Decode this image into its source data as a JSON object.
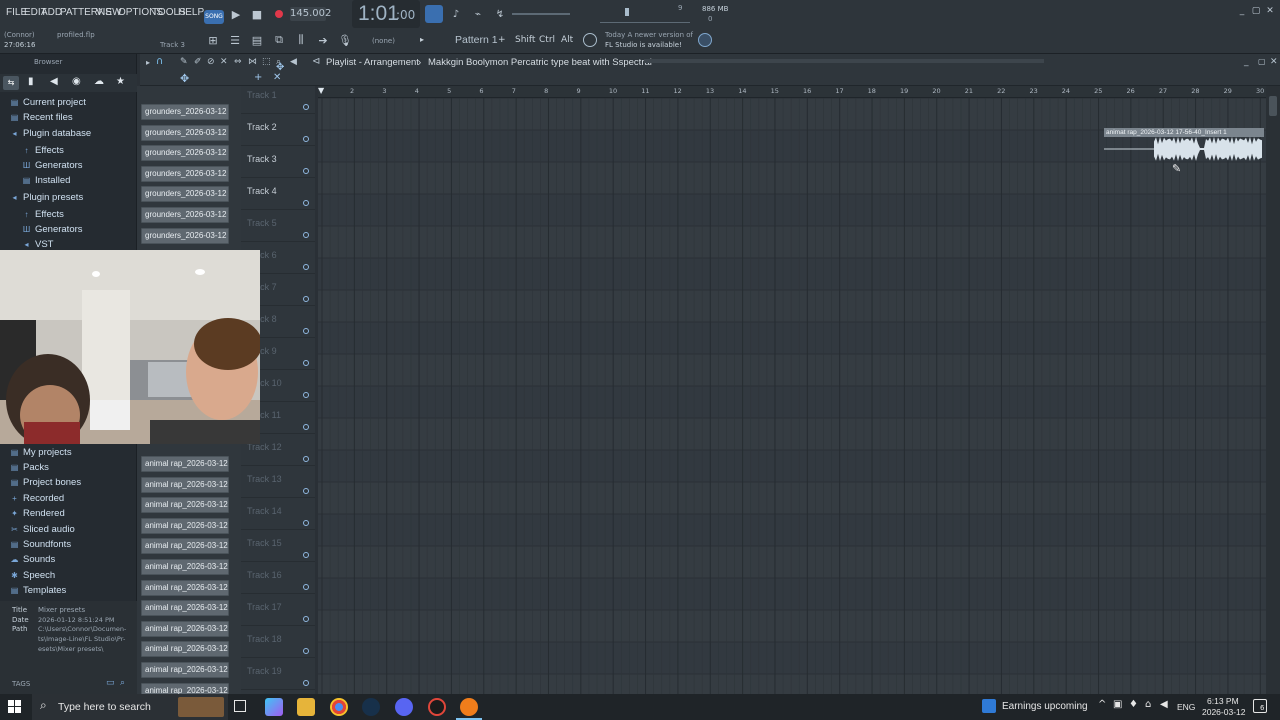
{
  "menu": {
    "items": [
      "FILE",
      "EDIT",
      "ADD",
      "PATTERNS",
      "VIEW",
      "OPTIONS",
      "TOOLS",
      "HELP"
    ]
  },
  "transport": {
    "mode_label": "SONG",
    "tempo": "145.002",
    "time": "1:01",
    "time_sub": ":00",
    "pattern": "Pattern 1",
    "pattern_none": "(none)",
    "memory": "886 MB",
    "cpu_top": "9",
    "cpu_bottom": "0"
  },
  "hint": {
    "line1": "(Connor)",
    "line2": "profiled.flp",
    "line3": "27:06:16",
    "track_label": "Track 3"
  },
  "modifiers": {
    "shift": "Shift",
    "ctrl": "Ctrl",
    "alt": "Alt"
  },
  "news": {
    "line1": "Today  A newer version of",
    "line2": "FL Studio is available!"
  },
  "playlist": {
    "breadcrumb": "Playlist - Arrangement",
    "project": "Makkgin Boolymon Percatric type beat with Sspectral",
    "clip_label": "animat rap_2026-03-12 17-56-40_Insert 1"
  },
  "browser": {
    "title": "Browser",
    "items": [
      {
        "label": "Current project",
        "icon": "folder-icon"
      },
      {
        "label": "Recent files",
        "icon": "folder-icon"
      },
      {
        "label": "Plugin database",
        "icon": "plug-icon"
      },
      {
        "label": "Effects",
        "icon": "effects-icon"
      },
      {
        "label": "Generators",
        "icon": "generators-icon"
      },
      {
        "label": "Installed",
        "icon": "installed-icon"
      },
      {
        "label": "Plugin presets",
        "icon": "plug-icon"
      },
      {
        "label": "Effects",
        "icon": "effects-icon"
      },
      {
        "label": "Generators",
        "icon": "generators-icon"
      },
      {
        "label": "VST",
        "icon": "vst-icon"
      }
    ],
    "items2": [
      {
        "label": "My projects",
        "icon": "folder-icon"
      },
      {
        "label": "Packs",
        "icon": "folder-icon"
      },
      {
        "label": "Project bones",
        "icon": "folder-icon"
      },
      {
        "label": "Recorded",
        "icon": "recorded-icon"
      },
      {
        "label": "Rendered",
        "icon": "rendered-icon"
      },
      {
        "label": "Sliced audio",
        "icon": "sliced-icon"
      },
      {
        "label": "Soundfonts",
        "icon": "soundfonts-icon"
      },
      {
        "label": "Sounds",
        "icon": "sounds-icon"
      },
      {
        "label": "Speech",
        "icon": "speech-icon"
      },
      {
        "label": "Templates",
        "icon": "folder-icon"
      }
    ],
    "info": {
      "title_k": "Title",
      "title_v": "Mixer presets",
      "date_k": "Date",
      "date_v": "2026-01-12 8:51:24 PM",
      "path_k": "Path",
      "path_v1": "C:\\Users\\Connor\\Documen-",
      "path_v2": "ts\\Image-Line\\FL Studio\\Pr-",
      "path_v3": "esets\\Mixer presets\\"
    },
    "tags": "TAGS"
  },
  "clips": {
    "top": [
      "grounders_2026-03-12 1...",
      "grounders_2026-03-12 1...",
      "grounders_2026-03-12 1...",
      "grounders_2026-03-12 1...",
      "grounders_2026-03-12 1...",
      "grounders_2026-03-12 1...",
      "grounders_2026-03-12 1..."
    ],
    "bottom": [
      "animal rap_2026-03-12...",
      "animal rap_2026-03-12...",
      "animal rap_2026-03-12...",
      "animal rap_2026-03-12...",
      "animal rap_2026-03-12...",
      "animal rap_2026-03-12...",
      "animal rap_2026-03-12...",
      "animal rap_2026-03-12...",
      "animal rap_2026-03-12...",
      "animal rap_2026-03-12...",
      "animal rap_2026-03-12...",
      "animal rap_2026-03-12..."
    ]
  },
  "tracks": [
    "Track 1",
    "Track 2",
    "Track 3",
    "Track 4",
    "Track 5",
    "Track 6",
    "Track 7",
    "Track 8",
    "Track 9",
    "Track 10",
    "Track 11",
    "Track 12",
    "Track 13",
    "Track 14",
    "Track 15",
    "Track 16",
    "Track 17",
    "Track 18",
    "Track 19"
  ],
  "ruler": [
    "2",
    "3",
    "4",
    "5",
    "6",
    "7",
    "8",
    "9",
    "10",
    "11",
    "12",
    "13",
    "14",
    "15",
    "16",
    "17",
    "18",
    "19",
    "20",
    "21",
    "22",
    "23",
    "24",
    "25",
    "26",
    "27",
    "28",
    "29",
    "30"
  ],
  "taskbar": {
    "search_placeholder": "Type here to search",
    "news": "Earnings upcoming",
    "lang": "ENG",
    "time": "6:13 PM",
    "date": "2026-03-12",
    "notif": "6"
  }
}
